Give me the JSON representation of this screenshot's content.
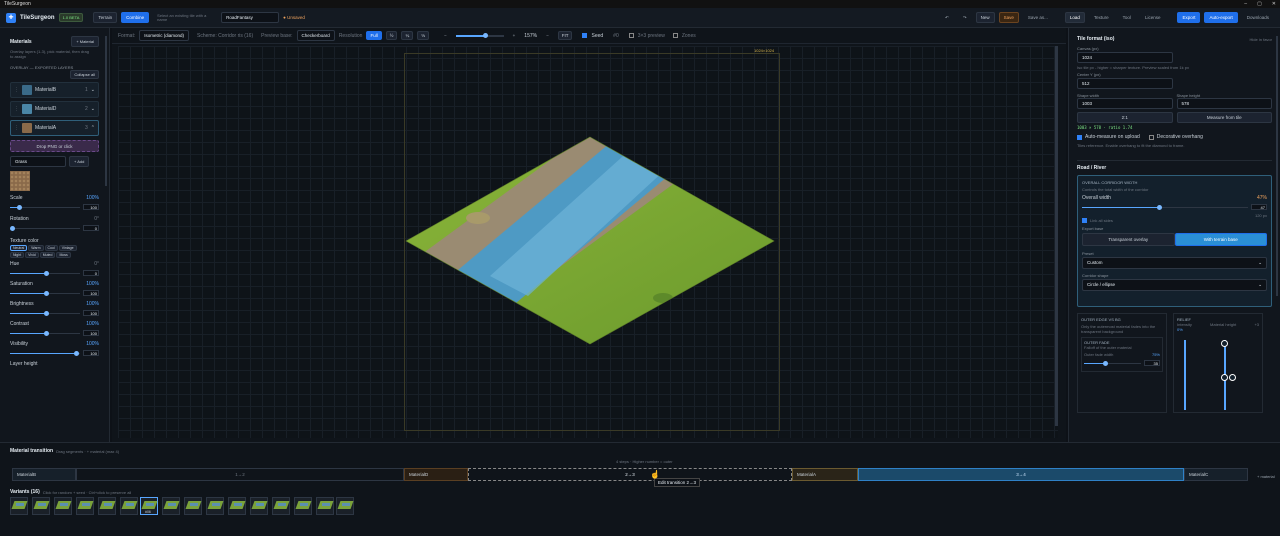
{
  "window": {
    "title": "TileSurgeon"
  },
  "toolbar": {
    "brand": "TileSurgeon",
    "version": "1.0 BETA",
    "terrain": "Terrain",
    "combine": "Combine",
    "hint": "Select an existing tile with a name",
    "project_name": "RoadFantasy",
    "unsaved": "● Unsaved",
    "new": "New",
    "save": "Save",
    "save_as": "Save as...",
    "load": "Load",
    "texture": "Texture",
    "tool": "Tool",
    "license": "License",
    "export": "Export",
    "auto_export": "Auto-export",
    "downloads": "Downloads"
  },
  "left": {
    "title": "Materials",
    "add_material": "+ Material",
    "desc": "Overlay layers (1-3), pick material, then drag to assign",
    "overlay_label": "OVERLAY — EXPORTED LAYERS",
    "collapse_all": "Collapse all",
    "layers": [
      {
        "name": "MaterialB",
        "idx": "1"
      },
      {
        "name": "MaterialD",
        "idx": "2"
      },
      {
        "name": "MaterialA",
        "idx": "3"
      }
    ],
    "drop": "Drop PNG or click",
    "select": "Grass",
    "add": "+ Add",
    "controls": [
      {
        "label": "Scale",
        "val": "100",
        "pct": "100%"
      },
      {
        "label": "Rotation",
        "val": "0",
        "pct": "0°"
      },
      {
        "label": "Texture color",
        "val": "",
        "pct": ""
      },
      {
        "label": "Hue",
        "val": "0",
        "pct": "0°"
      },
      {
        "label": "Saturation",
        "val": "100",
        "pct": "100%"
      },
      {
        "label": "Brightness",
        "val": "100",
        "pct": "100%"
      },
      {
        "label": "Contrast",
        "val": "100",
        "pct": "100%"
      },
      {
        "label": "Visibility",
        "val": "100",
        "pct": "100%"
      },
      {
        "label": "Layer height",
        "val": "",
        "pct": ""
      }
    ],
    "swatches": [
      "Neutral",
      "Warm",
      "Cool",
      "Vintage",
      "Night",
      "Vivid",
      "Muted",
      "Moss"
    ]
  },
  "center": {
    "format_label": "Format:",
    "format": "Isometric (diamond)",
    "scheme": "Scheme: Corridor ris (16)",
    "preview_label": "Preview base:",
    "preview": "Checkerboard",
    "resolution": "Resolution",
    "res_opts": [
      "Full",
      "½",
      "¼",
      "⅛"
    ],
    "zoom": "157%",
    "fit": "FIT",
    "seed": "Seed",
    "seed_val": "#0",
    "preview3": "3×3 preview",
    "zones": "Zones",
    "frame_size": "1024×1024"
  },
  "right": {
    "file_title": "Tile format (iso)",
    "hide": "Hide in favor",
    "canvas_label": "Canvas (px)",
    "canvas_val": "1024",
    "canvas_hint": "Iso tile px - higher = sharper texture. Preview scaled from 1k px",
    "centery_label": "Center Y (px)",
    "centery_val": "512",
    "shape_w_label": "Shape width",
    "shape_w": "1003",
    "shape_h_label": "Shape height",
    "shape_h": "578",
    "ratio": "2:1",
    "measure": "Measure from tile",
    "calc": "1003 × 578 · ratio 1.74",
    "auto_measure": "Auto-measure on upload",
    "decorative": "Decorative overhang",
    "tips": "Tiles reference. Enable overhang to fit the diamond to frame.",
    "road_title": "Road / River",
    "corridor": "OVERALL CORRIDOR WIDTH",
    "corridor_hint": "Controls the total width of the corridor",
    "overall_label": "Overall width",
    "overall_pct": "47%",
    "overall_val": "47",
    "px": "120 px",
    "link": "Link all sides",
    "export_mode": "Export base",
    "mode_a": "Transparent overlay",
    "mode_b": "With terrain base",
    "preset_label": "Preset",
    "preset": "Custom",
    "shape_label": "Corridor shape",
    "shape": "Circle / ellipse",
    "outer_title": "OUTER EDGE VS BG",
    "outer_desc": "Only the outermost material fades into the transparent background",
    "outer_fade": "OUTER FADE",
    "fade_desc": "Falloff of the outer material",
    "fade_label": "Outer fade width",
    "fade_pct": "75%",
    "fade_val": "35",
    "relief": "RELIEF",
    "intensity": "Intensity",
    "intensity_val": "0%",
    "mat_height": "Material height",
    "mat_val": "+3"
  },
  "bottom": {
    "title": "Material transition",
    "hint": "Drag segments · + material (max 4)",
    "center_hint": "4 steps · Higher number = outer",
    "segments": [
      "MaterialB",
      "1→2",
      "MaterialD",
      "2→3",
      "MaterialA",
      "3→4",
      "MaterialC"
    ],
    "add": "+ material",
    "tooltip": "Edit transition 2→3",
    "variants_title": "Variants (16)",
    "variants_hint": "Click for random + seed · Ctrl+click to preserve all",
    "active_variant": "#06"
  }
}
